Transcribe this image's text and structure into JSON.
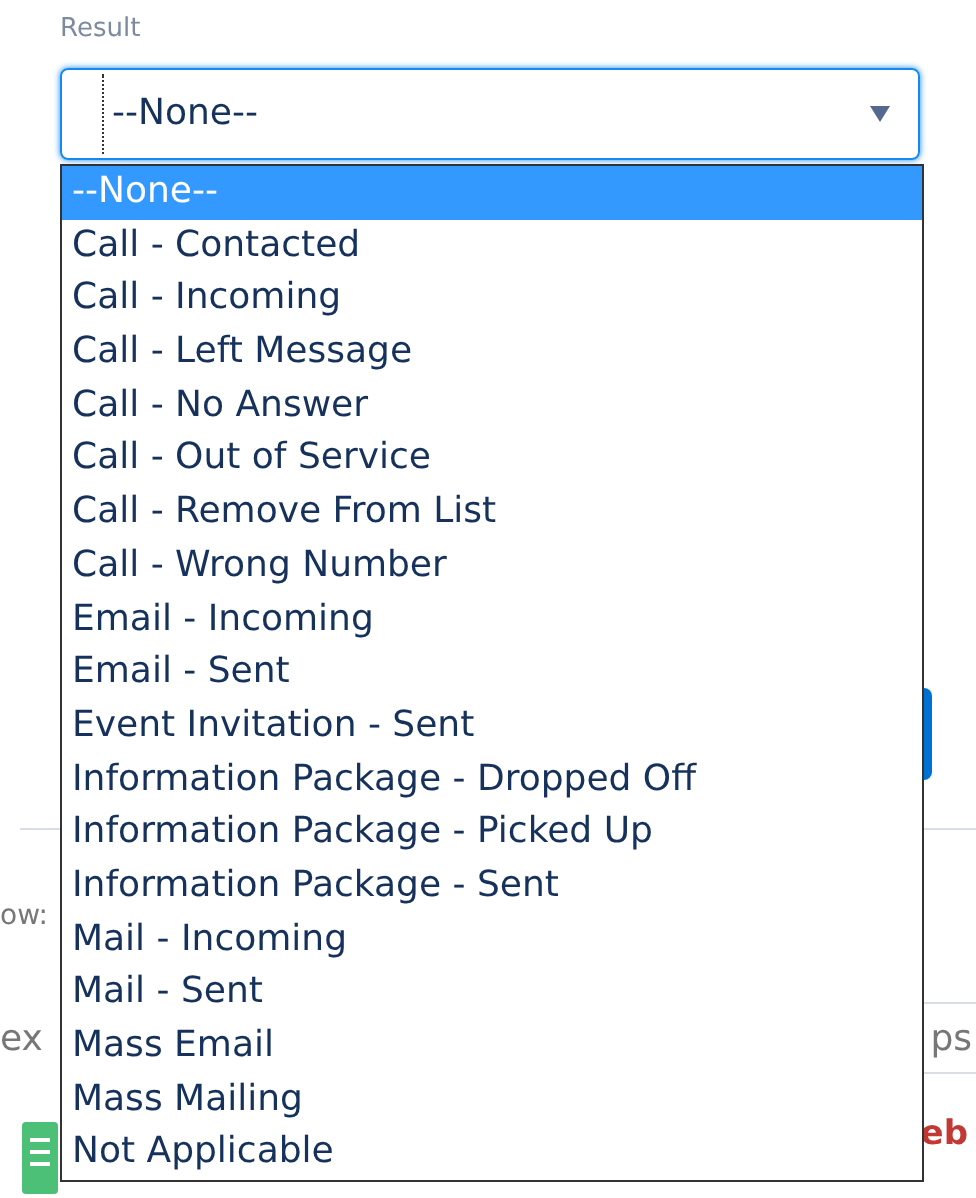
{
  "field": {
    "label": "Result",
    "value": "--None--"
  },
  "options": [
    {
      "label": "--None--",
      "selected": true
    },
    {
      "label": "Call - Contacted",
      "selected": false
    },
    {
      "label": "Call - Incoming",
      "selected": false
    },
    {
      "label": "Call - Left Message",
      "selected": false
    },
    {
      "label": "Call - No Answer",
      "selected": false
    },
    {
      "label": "Call - Out of Service",
      "selected": false
    },
    {
      "label": "Call - Remove From List",
      "selected": false
    },
    {
      "label": "Call - Wrong Number",
      "selected": false
    },
    {
      "label": "Email - Incoming",
      "selected": false
    },
    {
      "label": "Email - Sent",
      "selected": false
    },
    {
      "label": "Event Invitation - Sent",
      "selected": false
    },
    {
      "label": "Information Package - Dropped Off",
      "selected": false
    },
    {
      "label": "Information Package - Picked Up",
      "selected": false
    },
    {
      "label": "Information Package - Sent",
      "selected": false
    },
    {
      "label": "Mail - Incoming",
      "selected": false
    },
    {
      "label": "Mail - Sent",
      "selected": false
    },
    {
      "label": "Mass Email",
      "selected": false
    },
    {
      "label": "Mass Mailing",
      "selected": false
    },
    {
      "label": "Not Applicable",
      "selected": false
    }
  ],
  "background": {
    "left_text_1": "ow:",
    "left_text_2": "ex",
    "right_text": "ps",
    "right_date": "eb"
  }
}
